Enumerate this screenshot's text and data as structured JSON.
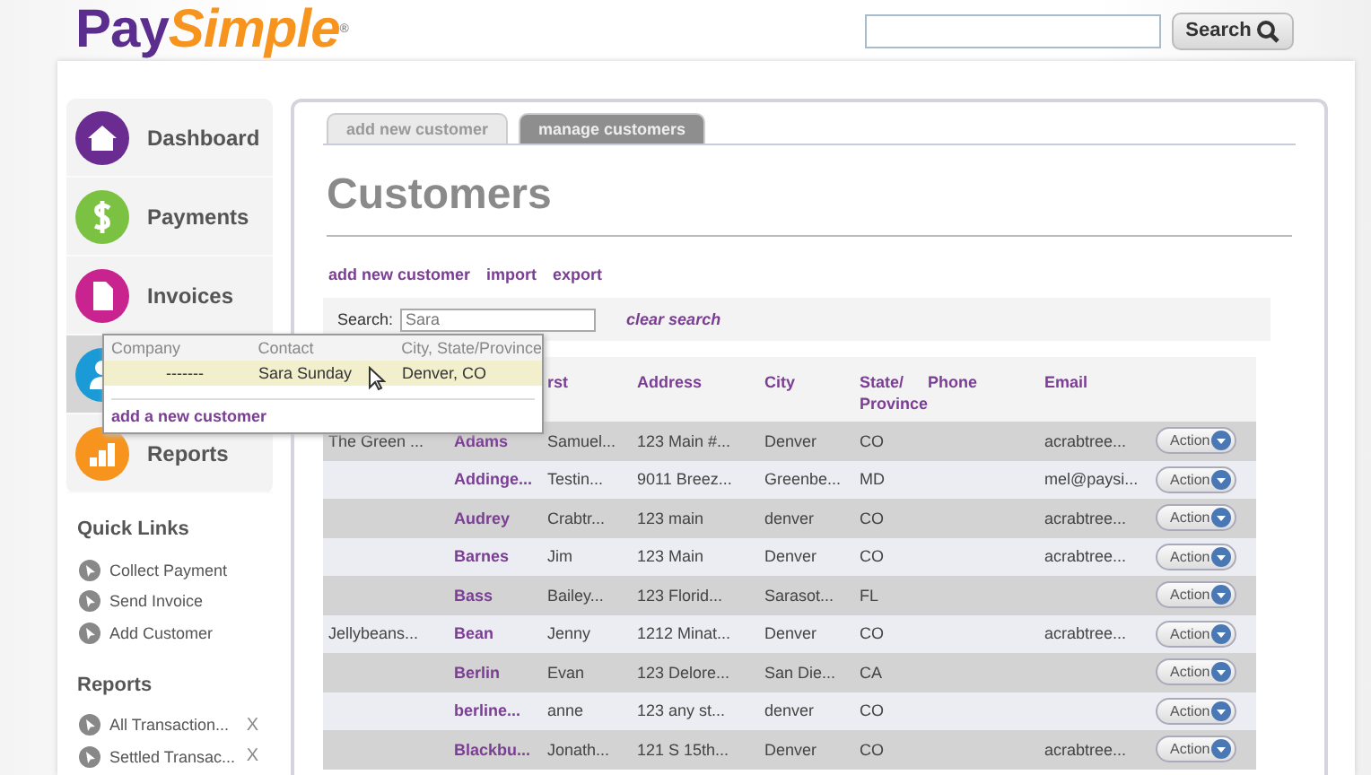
{
  "header": {
    "logo_part1": "Pay",
    "logo_part2": "Simple",
    "logo_mark": "®",
    "search": {
      "button": "Search"
    }
  },
  "nav": [
    {
      "label": "Dashboard",
      "selected": false
    },
    {
      "label": "Payments",
      "selected": false
    },
    {
      "label": "Invoices",
      "selected": false
    },
    {
      "selected": true
    },
    {
      "label": "Reports",
      "selected": false
    }
  ],
  "quick_links": {
    "title": "Quick Links",
    "items": [
      "Collect Payment",
      "Send Invoice",
      "Add Customer"
    ]
  },
  "reports": {
    "title": "Reports",
    "items": [
      {
        "label": "All Transaction...",
        "remove": "X"
      },
      {
        "label": "Settled Transac...",
        "remove": "X"
      }
    ]
  },
  "tabs": [
    {
      "label": "add new customer",
      "selected": false
    },
    {
      "label": "manage customers",
      "selected": true
    }
  ],
  "title": "Customers",
  "actions": [
    "add new customer",
    "import",
    "export"
  ],
  "search": {
    "label": "Search:",
    "value": "Sara",
    "clear": "clear search"
  },
  "autocomplete": {
    "columns": [
      "Company",
      "Contact",
      "City, State/Province"
    ],
    "rows": [
      {
        "company": "-------",
        "contact": "Sara Sunday",
        "city": "Denver, CO",
        "selected": true
      }
    ],
    "add": "add a new customer"
  },
  "table": {
    "visible_column_headings": [
      "rst",
      "Address",
      "City",
      "State/ Province",
      "Phone",
      "Email"
    ],
    "rows": [
      {
        "company": "The Green ...",
        "last": "Adams",
        "first": "Samuel...",
        "address": "123 Main #...",
        "city": "Denver",
        "state": "CO",
        "email": "acrabtree...",
        "action": "Action"
      },
      {
        "last": "Addinge...",
        "first": "Testin...",
        "address": "9011 Breez...",
        "city": "Greenbe...",
        "state": "MD",
        "email": "mel@paysi...",
        "action": "Action"
      },
      {
        "last": "Audrey",
        "first": "Crabtr...",
        "address": "123 main",
        "city": "denver",
        "state": "CO",
        "email": "acrabtree...",
        "action": "Action"
      },
      {
        "last": "Barnes",
        "first": "Jim",
        "address": "123 Main",
        "city": "Denver",
        "state": "CO",
        "email": "acrabtree...",
        "action": "Action"
      },
      {
        "last": "Bass",
        "first": "Bailey...",
        "address": "123 Florid...",
        "city": "Sarasot...",
        "state": "FL",
        "action": "Action"
      },
      {
        "company": "Jellybeans...",
        "last": "Bean",
        "first": "Jenny",
        "address": "1212 Minat...",
        "city": "Denver",
        "state": "CO",
        "email": "acrabtree...",
        "action": "Action"
      },
      {
        "last": "Berlin",
        "first": "Evan",
        "address": "123 Delore...",
        "city": "San Die...",
        "state": "CA",
        "action": "Action"
      },
      {
        "last": "berline...",
        "first": "anne",
        "address": "123 any st...",
        "city": "denver",
        "state": "CO",
        "action": "Action"
      },
      {
        "last": "Blackbu...",
        "first": "Jonath...",
        "address": "121 S 15th...",
        "city": "Denver",
        "state": "CO",
        "email": "acrabtree...",
        "action": "Action"
      }
    ]
  }
}
